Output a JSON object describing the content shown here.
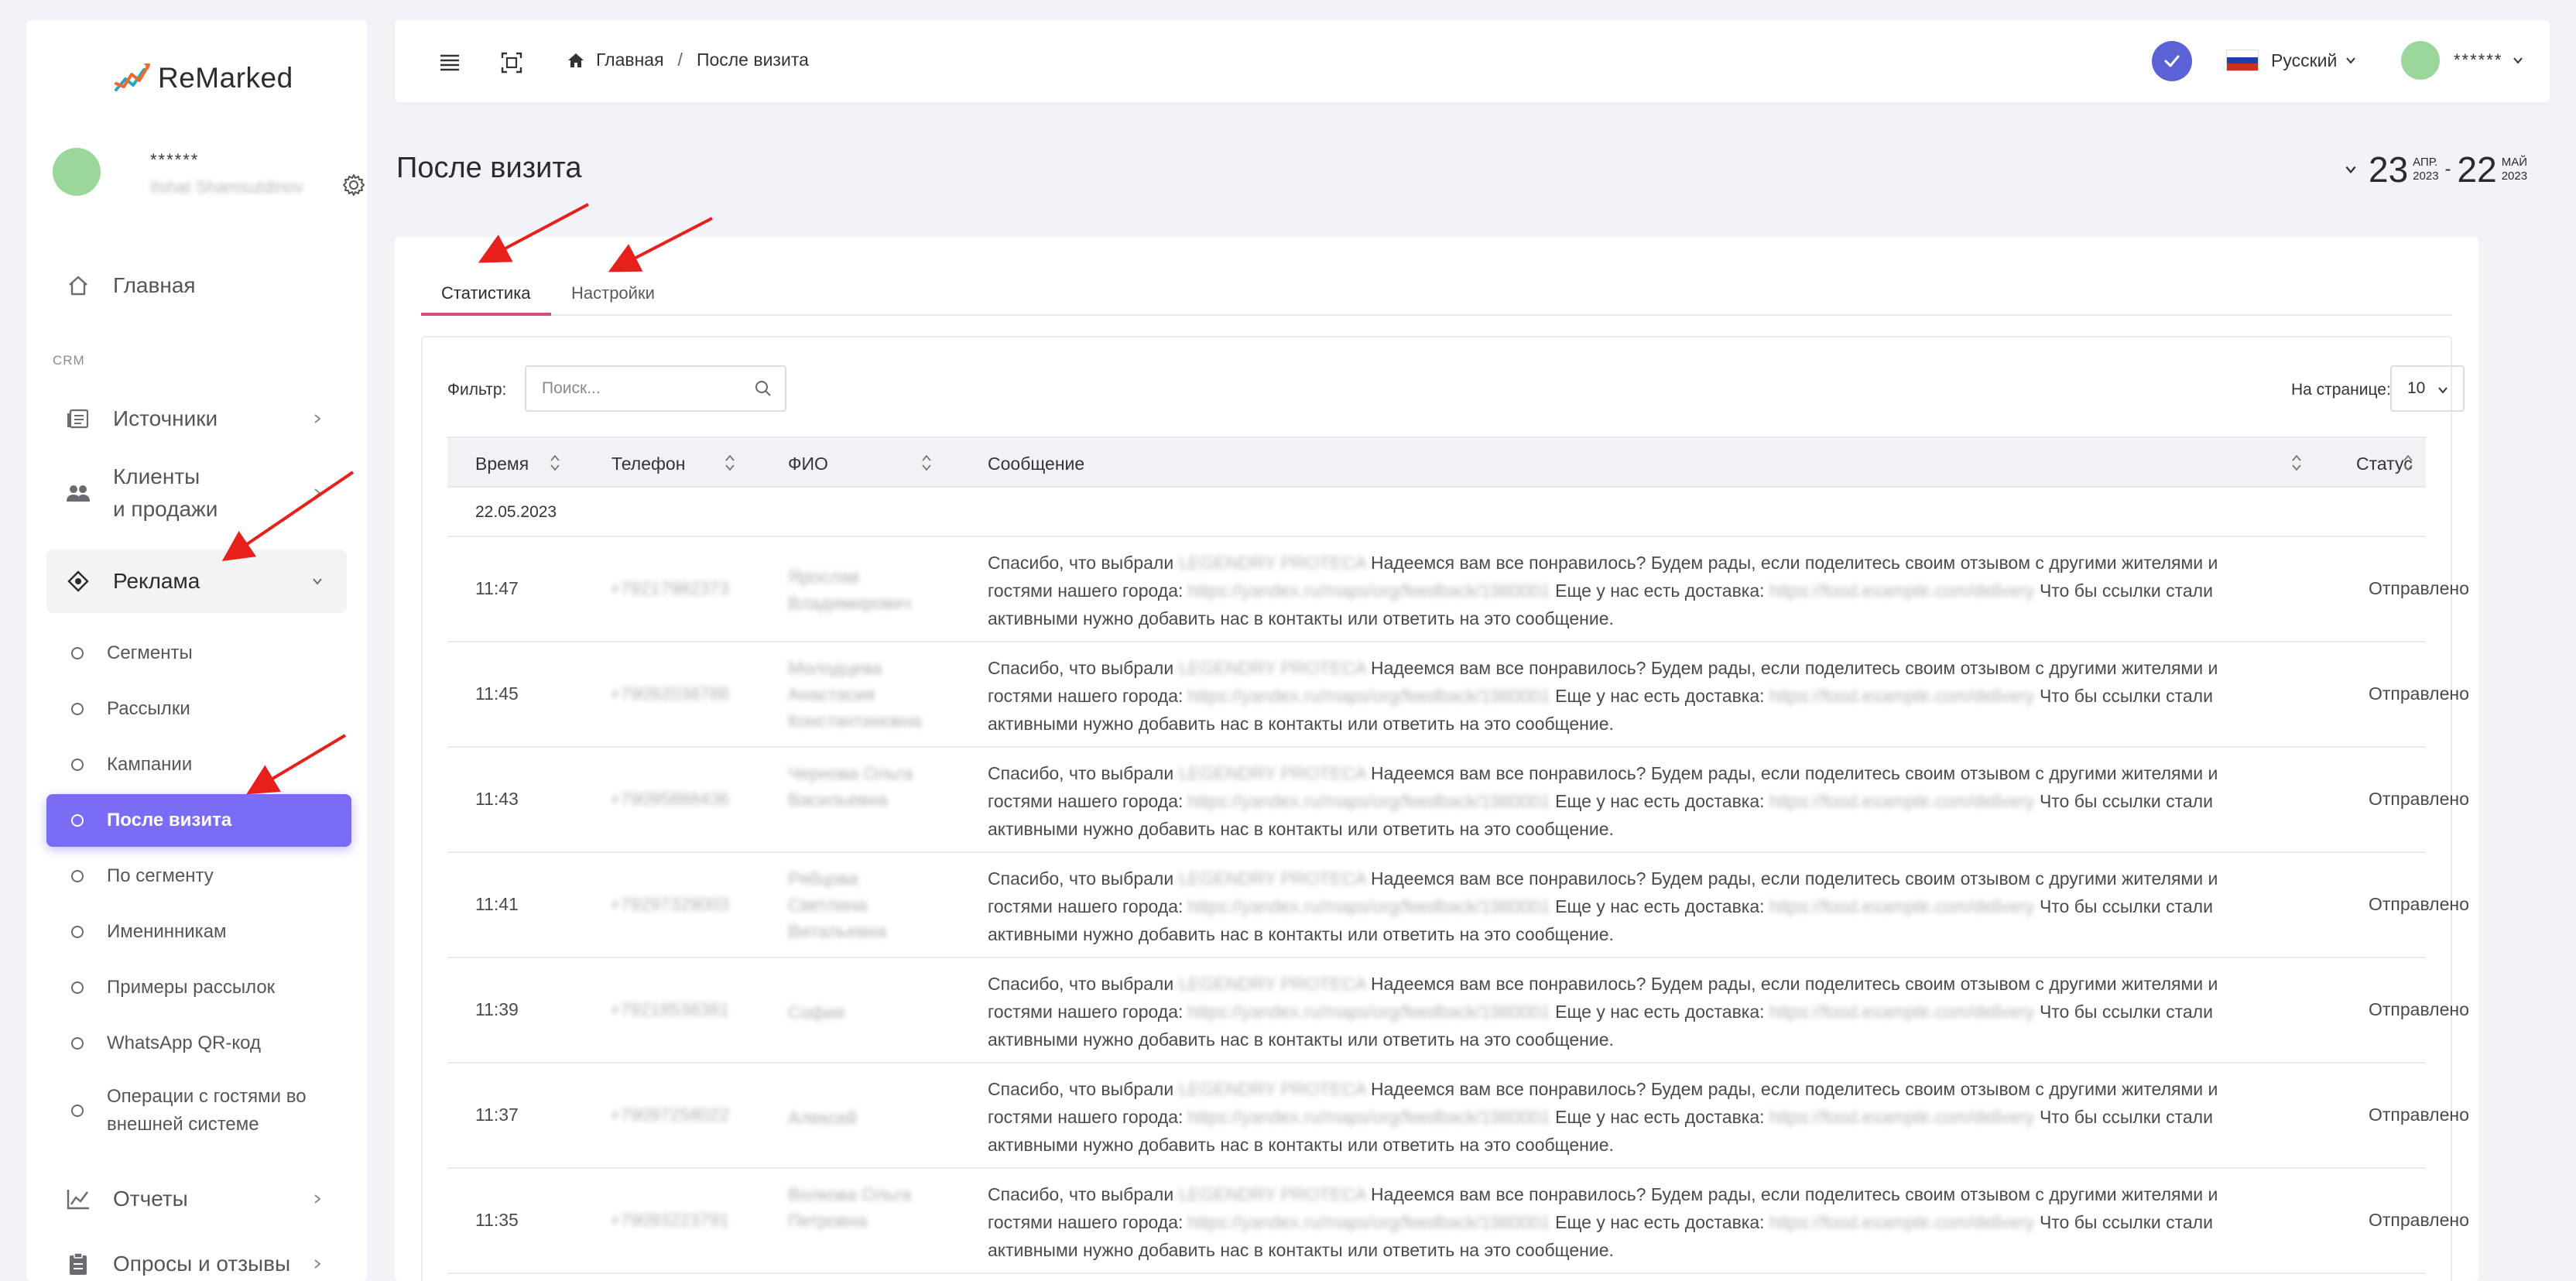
{
  "app": {
    "name": "ReMarked"
  },
  "sidebar": {
    "user_name": "******",
    "user_sub": "Ilshat Shamsutdinov",
    "items_top": [
      {
        "label": "Главная",
        "icon": "home-icon"
      }
    ],
    "section_label": "CRM",
    "items_crm": [
      {
        "label": "Источники",
        "icon": "sources-icon"
      },
      {
        "label": "Клиенты\nи продажи",
        "icon": "clients-icon"
      },
      {
        "label": "Реклама",
        "icon": "ads-icon"
      }
    ],
    "sub_items": [
      {
        "label": "Сегменты"
      },
      {
        "label": "Рассылки"
      },
      {
        "label": "Кампании"
      },
      {
        "label": "После визита",
        "active": true
      },
      {
        "label": "По сегменту"
      },
      {
        "label": "Именинникам"
      },
      {
        "label": "Примеры рассылок"
      },
      {
        "label": "WhatsApp QR-код"
      },
      {
        "label": "Операции с гостями во\nвнешней системе"
      }
    ],
    "items_bottom": [
      {
        "label": "Отчеты",
        "icon": "reports-icon"
      },
      {
        "label": "Опросы и отзывы",
        "icon": "surveys-icon"
      }
    ]
  },
  "topbar": {
    "breadcrumb_home": "Главная",
    "breadcrumb_current": "После визита",
    "language": "Русский",
    "user": "******",
    "accent": "#5b62d6"
  },
  "page": {
    "title": "После визита",
    "date_from_day": "23",
    "date_from_month": "АПР.",
    "date_from_year": "2023",
    "date_to_day": "22",
    "date_to_month": "МАЙ",
    "date_to_year": "2023"
  },
  "tabs": [
    {
      "label": "Статистика",
      "active": true
    },
    {
      "label": "Настройки",
      "active": false
    }
  ],
  "filter": {
    "label": "Фильтр:",
    "placeholder": "Поиск..."
  },
  "per_page": {
    "label": "На странице:",
    "value": "10"
  },
  "table": {
    "columns": [
      "Время",
      "Телефон",
      "ФИО",
      "Сообщение",
      "Статус"
    ],
    "date_group": "22.05.2023",
    "message_parts": {
      "p1": "Спасибо, что выбрали",
      "blur1": "LEGENDRY PROTECA",
      "p2": "Надеемся вам все понравилось? Будем рады, если поделитесь своим отзывом с другими жителями и гостями нашего города:",
      "blur2": "https://yandex.ru/maps/org/feedback/1980001",
      "p3": "Еще у нас есть доставка:",
      "blur3": "https://food.example.com/delivery",
      "p4": "Что бы ссылки стали активными нужно добавить нас в контакты или ответить на это сообщение."
    },
    "rows": [
      {
        "time": "11:47",
        "phone": "+79217982373",
        "fio": "Ярослав Владимирович",
        "status": "Отправлено"
      },
      {
        "time": "11:45",
        "phone": "+79092038788",
        "fio": "Молодцева Анастасия Константиновна",
        "status": "Отправлено"
      },
      {
        "time": "11:43",
        "phone": "+79095888436",
        "fio": "Чернова Ольга Васильевна",
        "status": "Отправлено"
      },
      {
        "time": "11:41",
        "phone": "+79297329003",
        "fio": "Рябцова Светлана Витальевна",
        "status": "Отправлено"
      },
      {
        "time": "11:39",
        "phone": "+79218538381",
        "fio": "София",
        "status": "Отправлено"
      },
      {
        "time": "11:37",
        "phone": "+79097258022",
        "fio": "Алексей",
        "status": "Отправлено"
      },
      {
        "time": "11:35",
        "phone": "+79093223791",
        "fio": "Волкова Ольга Петровна",
        "status": "Отправлено"
      }
    ]
  },
  "colors": {
    "active_nav": "#7b6cf5",
    "tab_underline": "#d64a86",
    "annotation_arrow": "#e8201c"
  }
}
